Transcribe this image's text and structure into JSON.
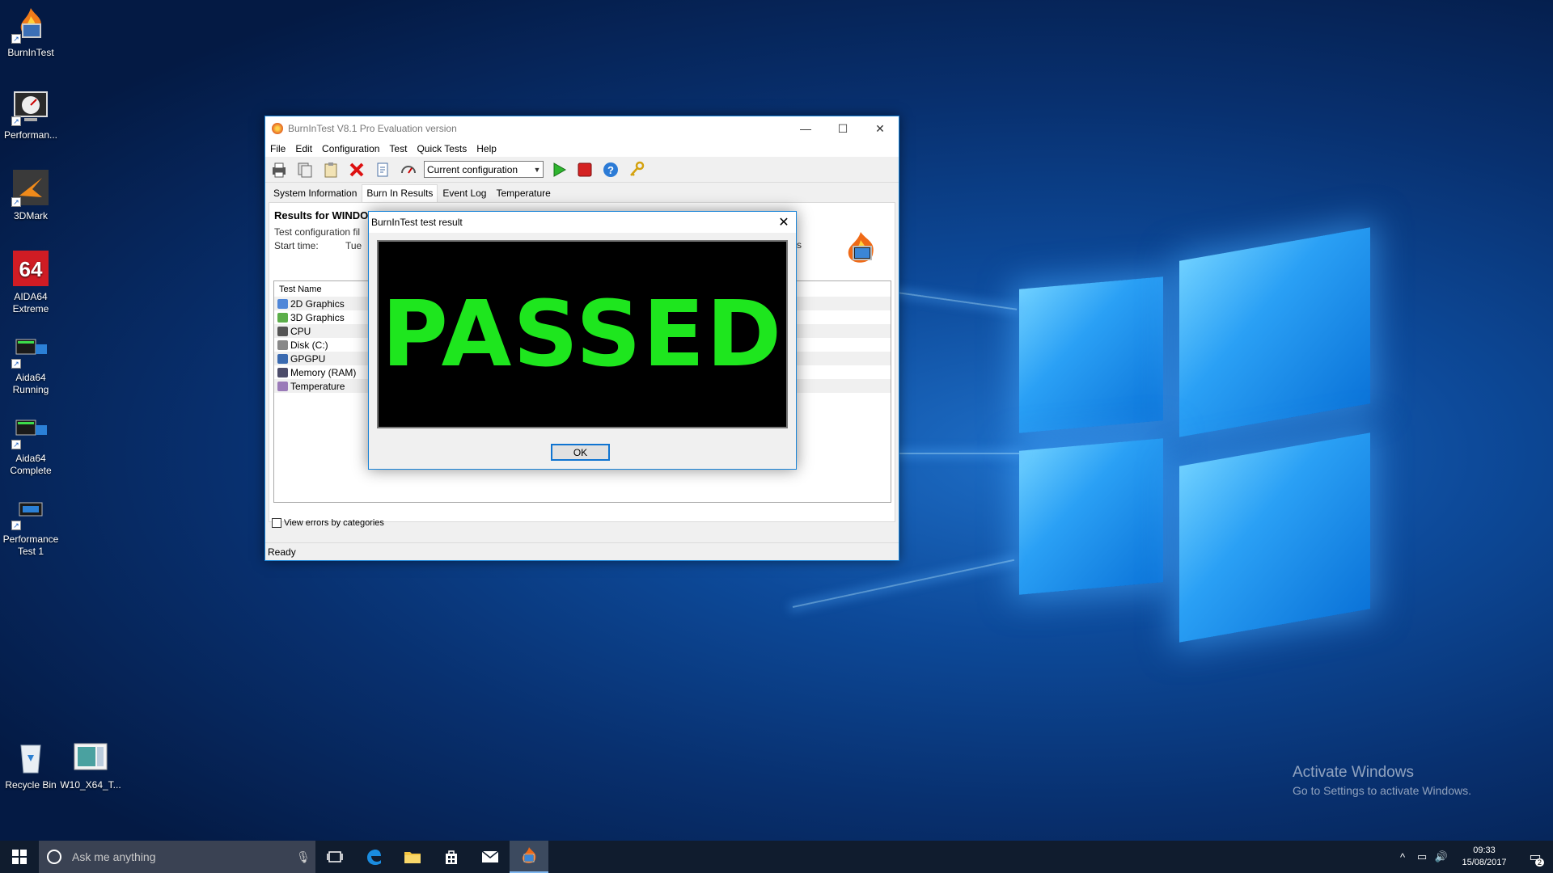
{
  "desktop_icons": [
    {
      "label": "BurnInTest",
      "icon": "burnintest-icon"
    },
    {
      "label": "Performan...",
      "icon": "performance-test-icon"
    },
    {
      "label": "3DMark",
      "icon": "3dmark-icon"
    },
    {
      "label": "AIDA64\nExtreme",
      "icon": "aida64-icon"
    },
    {
      "label": "Aida64\nRunning",
      "icon": "monitor-icon"
    },
    {
      "label": "Aida64\nComplete",
      "icon": "monitor-icon"
    },
    {
      "label": "Performance\nTest 1",
      "icon": "monitor-icon"
    },
    {
      "label": "Recycle Bin",
      "icon": "recycle-bin-icon"
    },
    {
      "label": "W10_X64_T...",
      "icon": "image-file-icon"
    }
  ],
  "activation": {
    "line1": "Activate Windows",
    "line2": "Go to Settings to activate Windows."
  },
  "main_window": {
    "title": "BurnInTest V8.1 Pro Evaluation version",
    "menu": [
      "File",
      "Edit",
      "Configuration",
      "Test",
      "Quick Tests",
      "Help"
    ],
    "config_combo": "Current configuration",
    "tabs": [
      "System Information",
      "Burn In Results",
      "Event Log",
      "Temperature"
    ],
    "active_tab": "Burn In Results",
    "results_title": "Results for WINDO",
    "config_file_label": "Test configuration fil",
    "start_time_label": "Start time:",
    "start_time_value": "Tue",
    "right_fragment": "s",
    "list_header": "Test Name",
    "tests": [
      "2D Graphics",
      "3D Graphics",
      "CPU",
      "Disk (C:)",
      "GPGPU",
      "Memory (RAM)",
      "Temperature"
    ],
    "checkbox_label": "View errors by categories",
    "status": "Ready"
  },
  "dialog": {
    "title": "BurnInTest test result",
    "result": "PASSED",
    "ok": "OK",
    "result_color": "#1ee61e"
  },
  "taskbar": {
    "search_placeholder": "Ask me anything",
    "time": "09:33",
    "date": "15/08/2017",
    "notification_count": "2"
  }
}
